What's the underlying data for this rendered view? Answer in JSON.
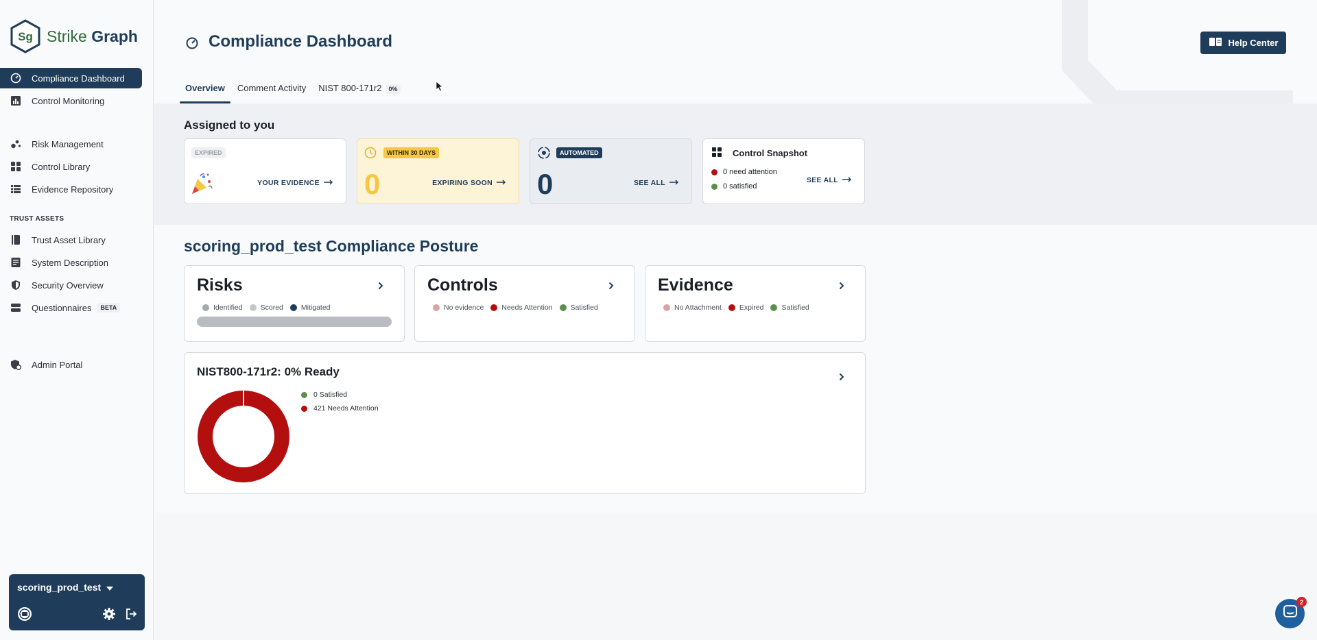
{
  "brand": {
    "name_part1": "Strike",
    "name_part2": "Graph",
    "mark": "Sg"
  },
  "sidebar": {
    "items": [
      {
        "label": "Compliance Dashboard",
        "icon": "gauge-icon",
        "active": true
      },
      {
        "label": "Control Monitoring",
        "icon": "bar-chart-icon"
      },
      {
        "label": "Risk Management",
        "icon": "risk-dots-icon"
      },
      {
        "label": "Control Library",
        "icon": "grid-icon"
      },
      {
        "label": "Evidence Repository",
        "icon": "list-icon"
      }
    ],
    "trust_section_label": "TRUST ASSETS",
    "trust_items": [
      {
        "label": "Trust Asset Library",
        "icon": "book-icon"
      },
      {
        "label": "System Description",
        "icon": "document-icon"
      },
      {
        "label": "Security Overview",
        "icon": "shield-icon"
      },
      {
        "label": "Questionnaires",
        "icon": "stack-icon",
        "badge": "BETA"
      }
    ],
    "admin_item": {
      "label": "Admin Portal",
      "icon": "admin-shield-icon"
    },
    "org": {
      "name": "scoring_prod_test"
    }
  },
  "header": {
    "title": "Compliance Dashboard",
    "help_label": "Help Center",
    "tabs": [
      {
        "label": "Overview",
        "active": true
      },
      {
        "label": "Comment Activity"
      },
      {
        "label": "NIST 800-171r2",
        "badge": "0%"
      }
    ]
  },
  "assigned": {
    "title": "Assigned to you",
    "cards": [
      {
        "chip": "EXPIRED",
        "link": "YOUR EVIDENCE"
      },
      {
        "chip": "WITHIN 30 DAYS",
        "value": "0",
        "link": "EXPIRING SOON"
      },
      {
        "chip": "AUTOMATED",
        "value": "0",
        "link": "SEE ALL"
      },
      {
        "title": "Control Snapshot",
        "row1": "0 need attention",
        "row2": "0 satisfied",
        "link": "SEE ALL"
      }
    ]
  },
  "posture": {
    "title": "scoring_prod_test Compliance Posture",
    "risks": {
      "title": "Risks",
      "legend": [
        "Identified",
        "Scored",
        "Mitigated"
      ]
    },
    "controls": {
      "title": "Controls",
      "legend": [
        "No evidence",
        "Needs Attention",
        "Satisfied"
      ]
    },
    "evidence": {
      "title": "Evidence",
      "legend": [
        "No Attachment",
        "Expired",
        "Satisfied"
      ]
    },
    "nist": {
      "title": "NIST800-171r2: 0% Ready",
      "satisfied_label": "0 Satisfied",
      "needs_label": "421 Needs Attention",
      "satisfied": 0,
      "needs_attention": 421
    }
  },
  "colors": {
    "primary": "#1f3d5a",
    "red": "#b30f0f",
    "green": "#5b8f4e",
    "yellow": "#f4c842"
  },
  "chat": {
    "badge": "2"
  }
}
